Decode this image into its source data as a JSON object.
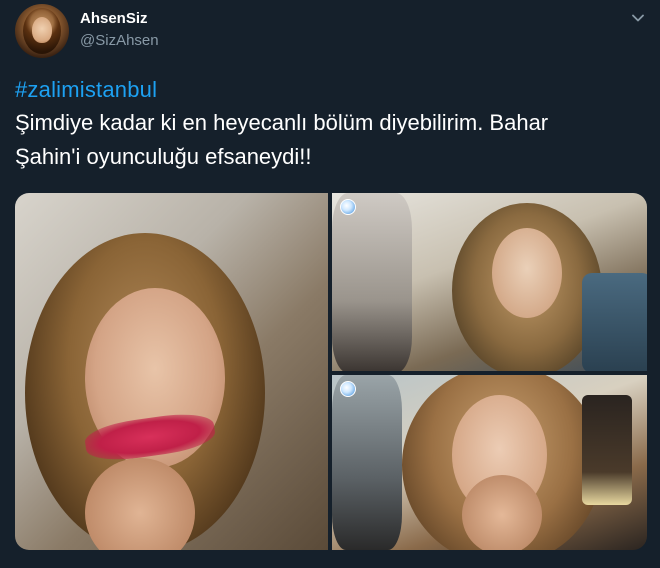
{
  "tweet": {
    "display_name": "AhsenSiz",
    "handle": "@SizAhsen",
    "hashtag": "#zalimistanbul",
    "text_line1": "Şimdiye kadar ki en heyecanlı bölüm diyebilirim.  Bahar",
    "text_line2": "Şahin'i oyunculuğu efsaneydi!!"
  },
  "media": {
    "count": 3
  },
  "colors": {
    "background": "#15202b",
    "accent_link": "#1da1f2",
    "secondary_text": "#8899a6",
    "primary_text": "#ffffff"
  },
  "icons": {
    "avatar": "portrait-avatar",
    "menu": "chevron-down-icon",
    "channel": "channel-logo-icon"
  }
}
